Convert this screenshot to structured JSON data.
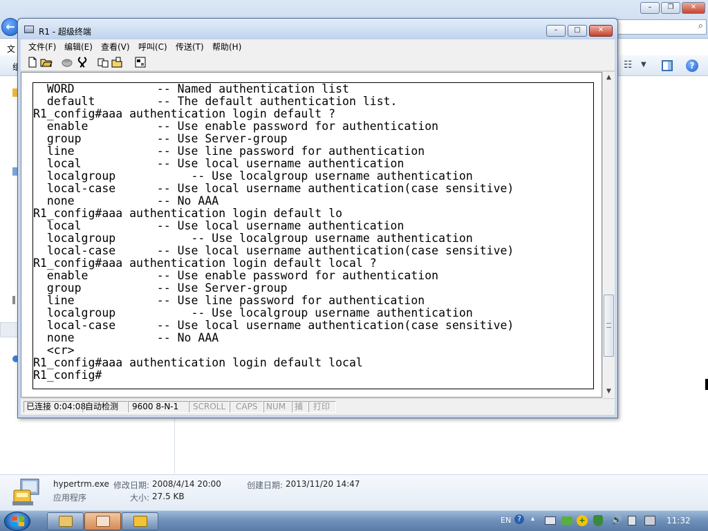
{
  "background_explorer": {
    "menu_fragment": "文",
    "toolbar_fragment": "组"
  },
  "details_pane": {
    "filename": "hypertrm.exe",
    "modified_label": "修改日期:",
    "modified_value": "2008/4/14 20:00",
    "created_label": "创建日期:",
    "created_value": "2013/11/20 14:47",
    "type": "应用程序",
    "size_label": "大小:",
    "size_value": "27.5 KB"
  },
  "window": {
    "title": "R1 - 超级终端"
  },
  "menu": [
    {
      "label": "文件(F)"
    },
    {
      "label": "编辑(E)"
    },
    {
      "label": "查看(V)"
    },
    {
      "label": "呼叫(C)"
    },
    {
      "label": "传送(T)"
    },
    {
      "label": "帮助(H)"
    }
  ],
  "toolbar_icons": [
    "new-icon",
    "open-icon",
    "phone-icon",
    "disconnect-icon",
    "send-icon",
    "receive-icon",
    "properties-icon"
  ],
  "terminal_lines": [
    "  WORD            -- Named authentication list",
    "  default         -- The default authentication list.",
    "R1_config#aaa authentication login default ?",
    "  enable          -- Use enable password for authentication",
    "  group           -- Use Server-group",
    "  line            -- Use line password for authentication",
    "  local           -- Use local username authentication",
    "  localgroup           -- Use localgroup username authentication",
    "  local-case      -- Use local username authentication(case sensitive)",
    "  none            -- No AAA",
    "R1_config#aaa authentication login default lo",
    "  local           -- Use local username authentication",
    "  localgroup           -- Use localgroup username authentication",
    "  local-case      -- Use local username authentication(case sensitive)",
    "R1_config#aaa authentication login default local ?",
    "  enable          -- Use enable password for authentication",
    "  group           -- Use Server-group",
    "  line            -- Use line password for authentication",
    "  localgroup           -- Use localgroup username authentication",
    "  local-case      -- Use local username authentication(case sensitive)",
    "  none            -- No AAA",
    "  <cr>",
    "R1_config#aaa authentication login default local",
    "R1_config#"
  ],
  "statusbar": {
    "connected": "已连接 0:04:08",
    "detect": "自动检测",
    "port": "9600 8-N-1",
    "scroll": "SCROLL",
    "caps": "CAPS",
    "num": "NUM",
    "capture": "捕",
    "print": "打印"
  },
  "scroll_thumb_position": 0.88,
  "taskbar": {
    "language": "EN",
    "clock": "11:32"
  },
  "colors": {
    "terminal_bg": "#ffffff",
    "terminal_text": "#000000",
    "window_chrome": "#c8d8ee",
    "close_red": "#c8402c"
  }
}
